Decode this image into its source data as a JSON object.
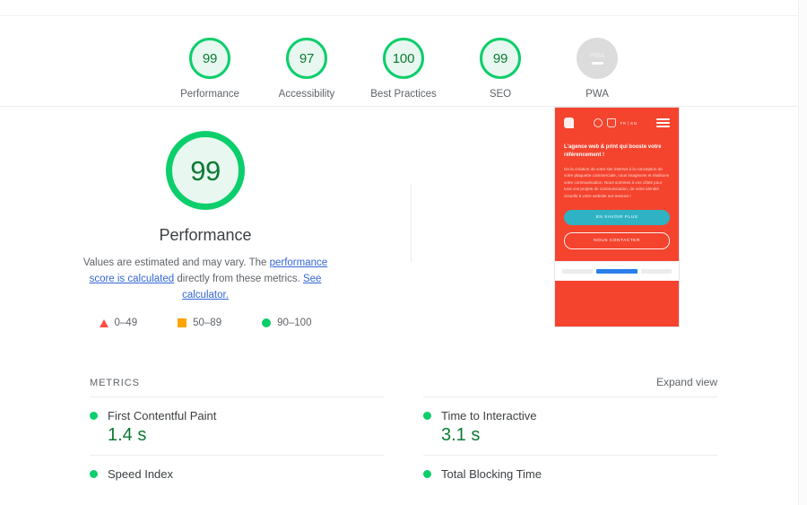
{
  "score_scales": [
    {
      "label": "Performance",
      "score": "99",
      "state": "pass"
    },
    {
      "label": "Accessibility",
      "score": "97",
      "state": "pass"
    },
    {
      "label": "Best Practices",
      "score": "100",
      "state": "pass"
    },
    {
      "label": "SEO",
      "score": "99",
      "state": "pass"
    },
    {
      "label": "PWA",
      "score": "PWA",
      "state": "none"
    }
  ],
  "performance": {
    "score": "99",
    "title": "Performance",
    "description_1": "Values are estimated and may vary. The ",
    "link_1": "performance score is calculated",
    "description_2": " directly from these metrics. ",
    "link_2": "See calculator.",
    "legend": [
      {
        "shape": "triangle",
        "range": "0–49",
        "color": "#ff4e42"
      },
      {
        "shape": "square",
        "range": "50–89",
        "color": "#ffa400"
      },
      {
        "shape": "circle",
        "range": "90–100",
        "color": "#0cce6b"
      }
    ]
  },
  "screenshot": {
    "lang_switch": "FR | EN",
    "headline": "L'agence web & print qui booste votre référencement !",
    "paragraph": "De la création de votre site internet à la conception de votre plaquette commerciale, nous imaginons et réalisons votre communication. Nous sommes à vos côtés pour tous vos projets de communication, de votre identité visuelle à votre website sur-mesure !",
    "primary_button": "EN SAVOIR PLUS",
    "secondary_button": "NOUS CONTACTER"
  },
  "metrics": {
    "section_title": "METRICS",
    "expand_view": "Expand view",
    "items": [
      {
        "name": "First Contentful Paint",
        "value": "1.4 s",
        "state": "pass"
      },
      {
        "name": "Time to Interactive",
        "value": "3.1 s",
        "state": "pass"
      },
      {
        "name": "Speed Index",
        "value": "",
        "state": "pass"
      },
      {
        "name": "Total Blocking Time",
        "value": "",
        "state": "pass"
      }
    ]
  },
  "colors": {
    "pass": "#0cce6b",
    "average": "#ffa400",
    "fail": "#ff4e42",
    "link": "#3367d6",
    "score_text": "#0b7a33",
    "brand_red": "#f4442e"
  }
}
